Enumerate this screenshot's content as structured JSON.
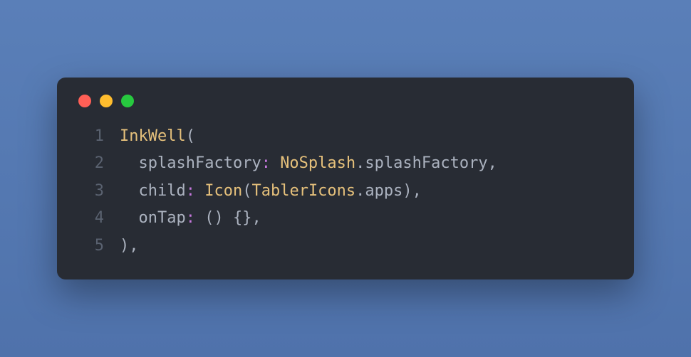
{
  "window": {
    "dots": [
      "red",
      "yellow",
      "green"
    ]
  },
  "code": {
    "lines": [
      {
        "n": "1",
        "indent": "",
        "tokens": [
          {
            "t": "InkWell",
            "c": "class"
          },
          {
            "t": "(",
            "c": "punct"
          }
        ]
      },
      {
        "n": "2",
        "indent": "  ",
        "tokens": [
          {
            "t": "splashFactory",
            "c": "prop"
          },
          {
            "t": ":",
            "c": "colon"
          },
          {
            "t": " ",
            "c": "plain"
          },
          {
            "t": "NoSplash",
            "c": "class"
          },
          {
            "t": ".",
            "c": "punct"
          },
          {
            "t": "splashFactory",
            "c": "method"
          },
          {
            "t": ",",
            "c": "punct"
          }
        ]
      },
      {
        "n": "3",
        "indent": "  ",
        "tokens": [
          {
            "t": "child",
            "c": "prop"
          },
          {
            "t": ":",
            "c": "colon"
          },
          {
            "t": " ",
            "c": "plain"
          },
          {
            "t": "Icon",
            "c": "class"
          },
          {
            "t": "(",
            "c": "punct"
          },
          {
            "t": "TablerIcons",
            "c": "class"
          },
          {
            "t": ".",
            "c": "punct"
          },
          {
            "t": "apps",
            "c": "method"
          },
          {
            "t": ")",
            "c": "punct"
          },
          {
            "t": ",",
            "c": "punct"
          }
        ]
      },
      {
        "n": "4",
        "indent": "  ",
        "tokens": [
          {
            "t": "onTap",
            "c": "prop"
          },
          {
            "t": ":",
            "c": "colon"
          },
          {
            "t": " () {},",
            "c": "plain"
          }
        ]
      },
      {
        "n": "5",
        "indent": "",
        "tokens": [
          {
            "t": "),",
            "c": "punct"
          }
        ]
      }
    ]
  }
}
